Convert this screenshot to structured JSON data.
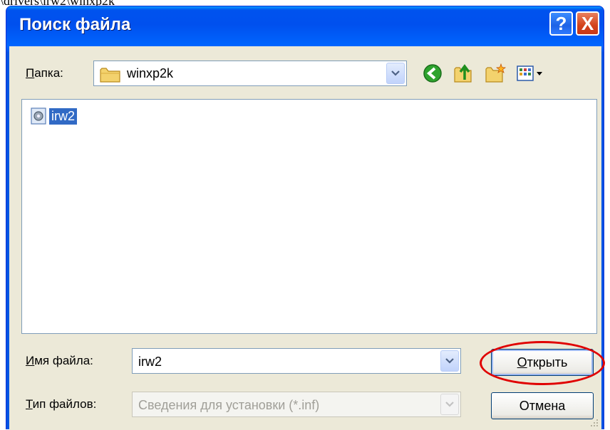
{
  "cropped_text": "\\drivers\\irw2\\winxp2k",
  "window": {
    "title": "Поиск файла"
  },
  "titlebar_buttons": {
    "help": "?",
    "close": "X"
  },
  "folder": {
    "label_prefix": "",
    "label_hot": "П",
    "label_rest": "апка:",
    "value": "winxp2k"
  },
  "toolbar": {
    "icons": [
      "back-icon",
      "up-folder-icon",
      "new-folder-icon",
      "view-menu-icon"
    ]
  },
  "files": [
    {
      "name": "irw2"
    }
  ],
  "file_name": {
    "label_hot": "И",
    "label_rest": "мя файла:",
    "value": "irw2"
  },
  "file_type": {
    "label_hot": "Т",
    "label_rest": "ип файлов:",
    "value": "Сведения для установки (*.inf)"
  },
  "buttons": {
    "open_hot": "О",
    "open_rest": "ткрыть",
    "cancel": "Отмена"
  },
  "colors": {
    "titlebar": "#0054e3",
    "client": "#ece9d8",
    "selection": "#316ac5",
    "highlight": "#e00000"
  }
}
